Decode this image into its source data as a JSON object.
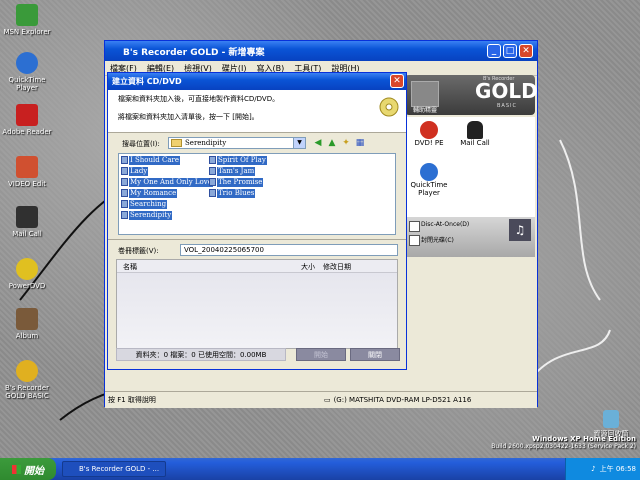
{
  "desktop": {
    "icons": [
      {
        "label": "MSN Explorer",
        "color": "#3a9a3a"
      },
      {
        "label": "QuickTime Player",
        "color": "#2c6fd2"
      },
      {
        "label": "Adobe Reader",
        "color": "#c82020"
      },
      {
        "label": "VIDEO Edit",
        "color": "#d05030"
      },
      {
        "label": "Mail Call",
        "color": "#303030"
      },
      {
        "label": "PowerDVD",
        "color": "#e0c020"
      },
      {
        "label": "Album",
        "color": "#7a5a3a"
      },
      {
        "label": "B's Recorder GOLD BASIC",
        "color": "#e0b020"
      }
    ],
    "recycle_label": "資源回收筒",
    "watermark_line1": "Windows XP Home Edition",
    "watermark_line2": "Build 2600.xpsp2.030422-1633 (Service Pack 2)"
  },
  "main": {
    "title": "B's Recorder GOLD - 新增專案",
    "menu": [
      "檔案(F)",
      "編輯(E)",
      "檢視(V)",
      "碟片(I)",
      "寫入(B)",
      "工具(T)",
      "說明(H)"
    ],
    "gold_logo": "GOLD",
    "gold_sub": "B's Recorder",
    "gold_basic": "BASIC",
    "help_label": "輔助精靈",
    "apps": [
      {
        "label": "DVD! PE"
      },
      {
        "label": "Mail Call"
      },
      {
        "label": "QuickTime Player"
      }
    ],
    "disc_at_once": "Disc-At-Once(D)",
    "close_disc": "封閉光碟(C)",
    "status_help": "按 F1 取得說明",
    "drive": "(G:) MATSHITA DVD-RAM LP-D521  A116"
  },
  "dialog": {
    "title": "建立資料 CD/DVD",
    "line1": "檔案和資料夾加入後，可直接地製作資料CD/DVD。",
    "line2": "將檔案和資料夾加入清單後，按一下 [開始]。",
    "lookin_label": "搜尋位置(I):",
    "lookin_value": "Serendipity",
    "files_col1": [
      "I Should Care",
      "Lady",
      "My One And Only Love",
      "My Romance",
      "Searching",
      "Serendipity"
    ],
    "files_col2": [
      "Spirit Of Play",
      "Tam's Jam",
      "The Promise",
      "Trio Blues"
    ],
    "vol_label": "卷冊標籤(V):",
    "vol_value": "VOL_20040225065700",
    "col_name": "名稱",
    "col_size": "大小",
    "col_date": "修改日期",
    "summary": "資料夾：0  檔案：0  已使用空間：0.00MB",
    "start_btn": "開始",
    "close_btn": "關閉"
  },
  "taskbar": {
    "start": "開始",
    "item": "B's Recorder GOLD - ...",
    "clock": "上午 06:58"
  }
}
